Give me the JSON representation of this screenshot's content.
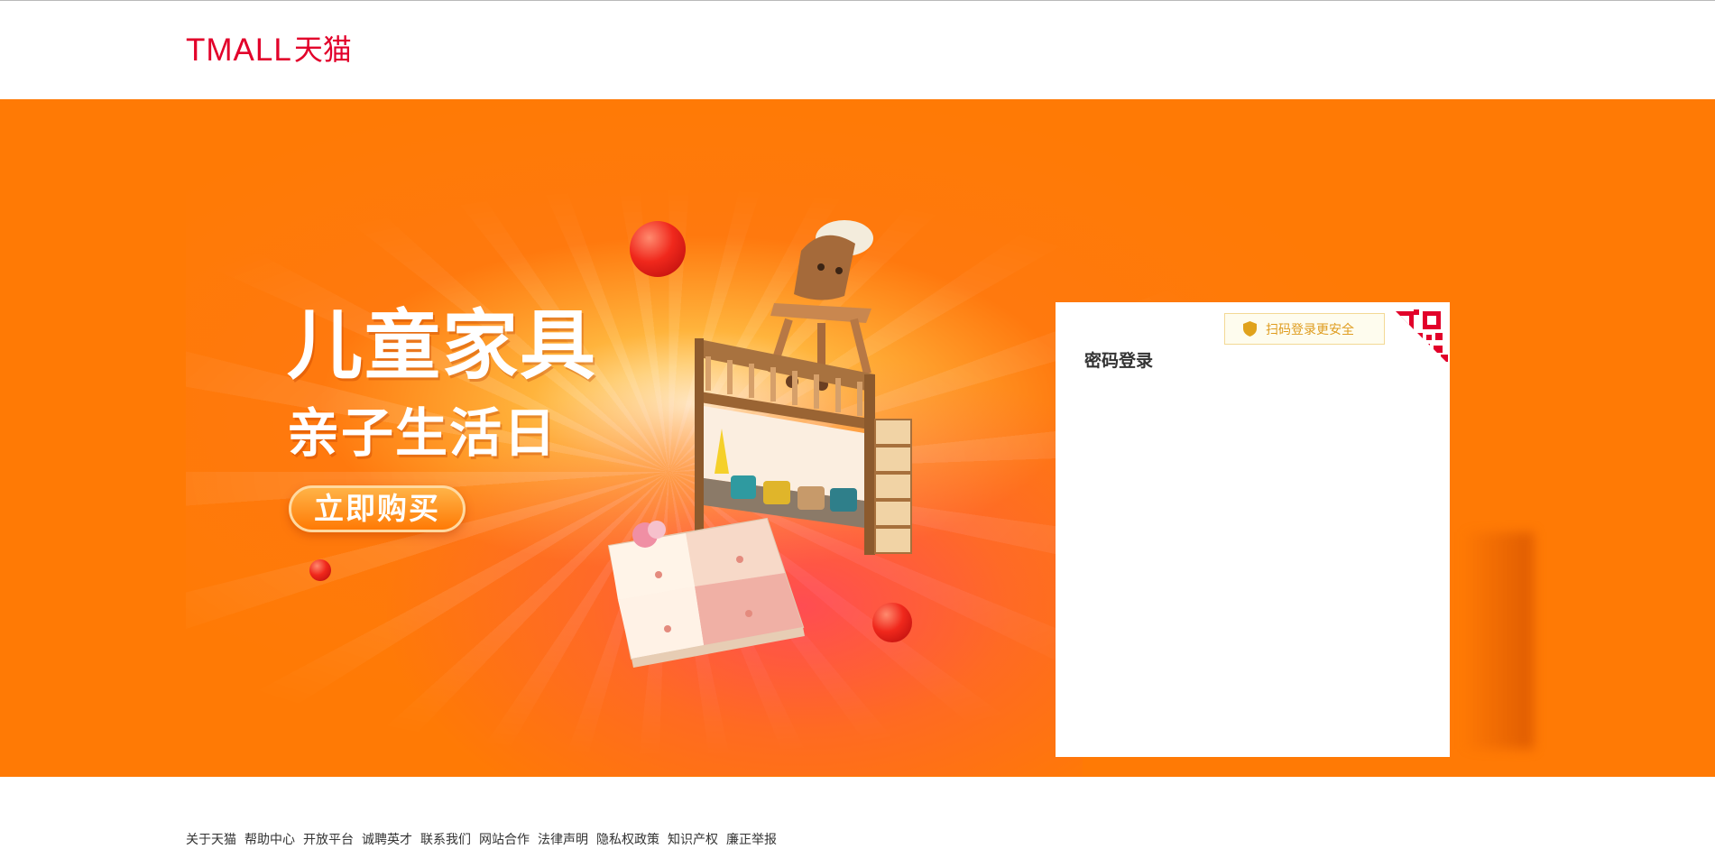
{
  "header": {
    "logo_latin": "TMALL",
    "logo_cn": "天猫",
    "brand_color": "#e2002a"
  },
  "banner": {
    "background_color": "#ff7a05",
    "headline": "儿童家具",
    "subheadline": "亲子生活日",
    "cta_label": "立即购买"
  },
  "login": {
    "title": "密码登录",
    "qr_tip": "扫码登录更安全",
    "qr_tip_icon": "shield-icon",
    "qr_switch_icon": "qr-code-icon"
  },
  "footer": {
    "links": [
      "关于天猫",
      "帮助中心",
      "开放平台",
      "诚聘英才",
      "联系我们",
      "网站合作",
      "法律声明",
      "隐私权政策",
      "知识产权",
      "廉正举报"
    ]
  }
}
